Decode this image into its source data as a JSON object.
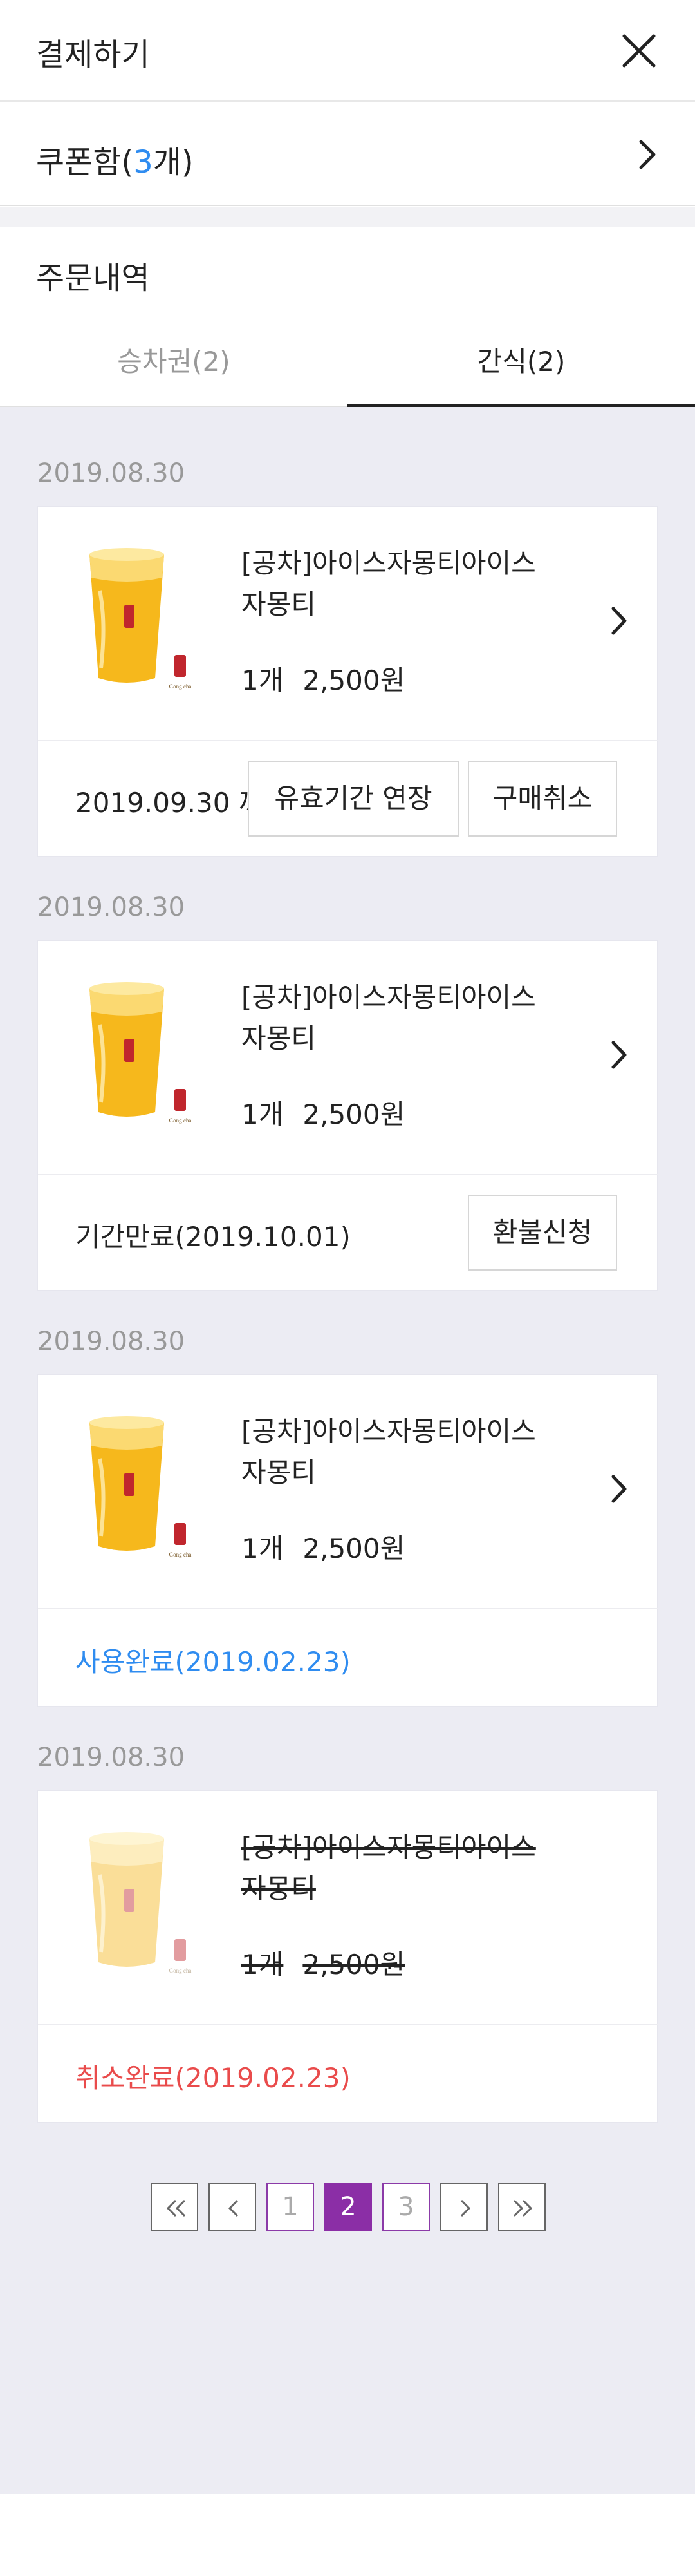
{
  "header": {
    "title": "결제하기",
    "close_icon": "close-icon"
  },
  "coupon": {
    "label_prefix": "쿠폰함(",
    "count": "3",
    "label_suffix": "개)",
    "chevron_icon": "chevron-right-icon"
  },
  "orders": {
    "title": "주문내역",
    "tabs": [
      {
        "label": "승차권(2)",
        "active": false
      },
      {
        "label": "간식(2)",
        "active": true
      }
    ],
    "items": [
      {
        "date": "2019.08.30",
        "name_line1": "[공차]아이스자몽티아이스",
        "name_line2": "자몽티",
        "qty": "1개",
        "price": "2,500원",
        "status": "2019.09.30 까지",
        "buttons": [
          "유효기간 연장",
          "구매취소"
        ]
      },
      {
        "date": "2019.08.30",
        "name_line1": "[공차]아이스자몽티아이스",
        "name_line2": "자몽티",
        "qty": "1개",
        "price": "2,500원",
        "status": "기간만료(2019.10.01)",
        "buttons": [
          "환불신청"
        ]
      },
      {
        "date": "2019.08.30",
        "name_line1": "[공차]아이스자몽티아이스",
        "name_line2": "자몽티",
        "qty": "1개",
        "price": "2,500원",
        "status": "사용완료(2019.02.23)",
        "status_color": "#2f8cf0"
      },
      {
        "date": "2019.08.30",
        "name_line1": "[공차]아이스자몽티아이스",
        "name_line2": "자몽티",
        "qty": "1개",
        "price": "2,500원",
        "status": "취소완료(2019.02.23)",
        "status_color": "#e94b4b"
      }
    ]
  },
  "pagination": {
    "pages": [
      "1",
      "2",
      "3"
    ],
    "current": "2",
    "active_color": "#8b2ea6"
  }
}
